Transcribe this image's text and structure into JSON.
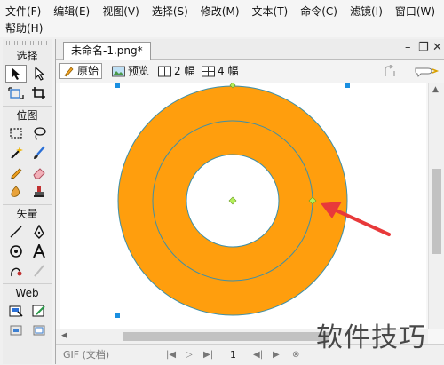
{
  "menu": {
    "row1": [
      "文件(F)",
      "编辑(E)",
      "视图(V)",
      "选择(S)",
      "修改(M)",
      "文本(T)",
      "命令(C)",
      "滤镜(I)",
      "窗口(W)"
    ],
    "row2": [
      "帮助(H)"
    ]
  },
  "tools_panel": {
    "sections": {
      "select": "选择",
      "bitmap": "位图",
      "vector": "矢量",
      "web": "Web"
    }
  },
  "document": {
    "tab_title": "未命名-1.png*",
    "view_buttons": {
      "original": "原始",
      "preview": "预览",
      "two_up": "2 幅",
      "four_up": "4 幅"
    },
    "status": {
      "format": "GIF (文档)",
      "frame": "1"
    }
  },
  "canvas": {
    "ring_color": "#FF9E0D",
    "stroke_color": "#3d8fa8",
    "arrow_color": "#e8393a",
    "handle_color": "#b4f05a",
    "selection_color": "#1a8fe0"
  },
  "watermark": "软件技巧",
  "accent": "#3c7fd1"
}
